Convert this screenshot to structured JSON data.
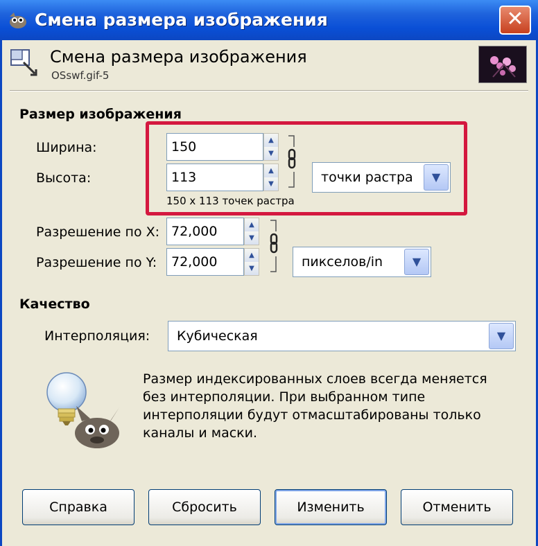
{
  "window": {
    "title": "Смена размера изображения",
    "close_label": "✕"
  },
  "header": {
    "title": "Смена размера изображения",
    "subtitle": "OSswf.gif-5"
  },
  "image_size": {
    "section_label": "Размер изображения",
    "width_label": "Ширина:",
    "width_value": "150",
    "height_label": "Высота:",
    "height_value": "113",
    "unit": "точки растра",
    "size_hint": "150 x 113 точек растра",
    "res_x_label": "Разрешение по X:",
    "res_x_value": "72,000",
    "res_y_label": "Разрешение по Y:",
    "res_y_value": "72,000",
    "res_unit": "пикселов/in"
  },
  "quality": {
    "section_label": "Качество",
    "interpolation_label": "Интерполяция:",
    "interpolation_value": "Кубическая"
  },
  "info_text": "Размер индексированных слоев всегда меняется без интерполяции. При выбранном типе интерполяции будут отмасштабированы только каналы и маски.",
  "buttons": {
    "help": "Справка",
    "reset": "Сбросить",
    "resize": "Изменить",
    "cancel": "Отменить"
  },
  "colors": {
    "titlebar": "#0A4FD6",
    "highlight": "#D4183F",
    "dialog_bg": "#ECE9D8"
  },
  "icons": [
    "gimp-app-icon",
    "close-icon",
    "resize-icon",
    "image-thumbnail",
    "spin-up-icon",
    "spin-down-icon",
    "chain-link-icon",
    "chevron-down-icon",
    "lightbulb-icon",
    "wilber-mascot-icon"
  ]
}
